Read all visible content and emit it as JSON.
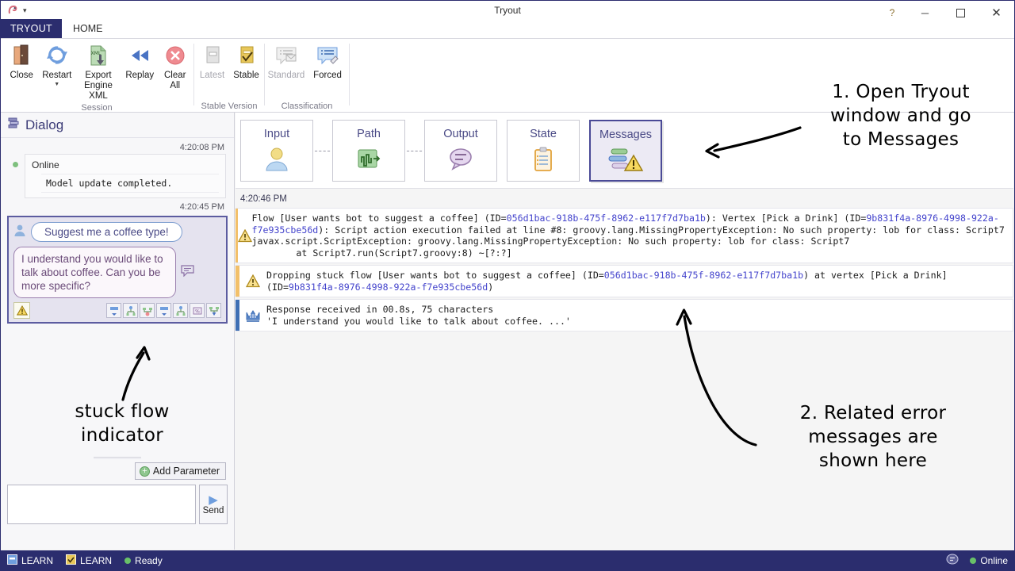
{
  "window": {
    "title": "Tryout",
    "help_glyph": "?",
    "minimize_glyph": "─",
    "maximize_glyph": "☐",
    "close_glyph": "✕",
    "collapse_glyph": "⌃",
    "qat_dropdown_glyph": "▾"
  },
  "tabs": {
    "app_tab": "TRYOUT",
    "ribbon_tab": "HOME"
  },
  "ribbon": {
    "groups": [
      {
        "title": "Session",
        "buttons": [
          {
            "label": "Close",
            "icon": "door-icon",
            "disabled": false,
            "dropdown": false
          },
          {
            "label": "Restart",
            "icon": "restart-icon",
            "disabled": false,
            "dropdown": true
          },
          {
            "label": "Export\nEngine XML",
            "label_line1": "Export",
            "label_line2": "Engine XML",
            "icon": "export-xml-icon",
            "disabled": false,
            "dropdown": false
          },
          {
            "label": "Replay",
            "icon": "rewind-icon",
            "disabled": false,
            "dropdown": false
          },
          {
            "label_line1": "Clear",
            "label_line2": "All",
            "label": "Clear All",
            "icon": "clear-all-icon",
            "disabled": false,
            "dropdown": false
          }
        ]
      },
      {
        "title": "Stable Version",
        "buttons": [
          {
            "label": "Latest",
            "icon": "latest-version-icon",
            "disabled": true,
            "dropdown": false
          },
          {
            "label": "Stable",
            "icon": "stable-version-icon",
            "disabled": false,
            "dropdown": false
          }
        ]
      },
      {
        "title": "Classification",
        "buttons": [
          {
            "label": "Standard",
            "icon": "standard-classification-icon",
            "disabled": true,
            "dropdown": false
          },
          {
            "label": "Forced",
            "icon": "forced-classification-icon",
            "disabled": false,
            "dropdown": false
          }
        ]
      }
    ]
  },
  "dialog": {
    "header": "Dialog",
    "header_icon": "dialog-icon",
    "system_message": {
      "timestamp": "4:20:08 PM",
      "status": "Online",
      "status_color": "#7ec07e",
      "text": "Model update completed."
    },
    "turn": {
      "timestamp": "4:20:45 PM",
      "user_text": "Suggest me a coffee type!",
      "bot_text": "I understand you would like to talk about coffee. Can you be more specific?",
      "warning_icon": "warning-triangle-icon",
      "tool_icons": [
        "input-transition-icon",
        "flow-node-icon",
        "stuck-flow-icon",
        "input-transition-icon",
        "flow-node-icon",
        "nlu-model-icon",
        "flow-tree-icon"
      ]
    },
    "add_parameter_label": "Add Parameter",
    "send_label": "Send",
    "send_input_value": "",
    "send_input_placeholder": ""
  },
  "main": {
    "tabs": [
      {
        "label": "Input",
        "icon": "user-icon",
        "active": false
      },
      {
        "label": "Path",
        "icon": "path-icon",
        "active": false
      },
      {
        "label": "Output",
        "icon": "speech-bubble-icon",
        "active": false
      },
      {
        "label": "State",
        "icon": "clipboard-icon",
        "active": false
      },
      {
        "label": "Messages",
        "icon": "messages-warning-icon",
        "active": true
      }
    ],
    "connector_glyph": "----",
    "log_timestamp": "4:20:46 PM",
    "log_rows": [
      {
        "severity": "warn",
        "icon": "warning-triangle-icon",
        "segments": [
          {
            "t": "Flow [User wants bot to suggest a coffee] (ID=",
            "link": false
          },
          {
            "t": "056d1bac-918b-475f-8962-e117f7d7ba1b",
            "link": true
          },
          {
            "t": "): Vertex [Pick a Drink] (ID=",
            "link": false
          },
          {
            "t": "9b831f4a-8976-4998-922a-f7e935cbe56d",
            "link": true
          },
          {
            "t": "): Script action execution failed at line #8: groovy.lang.MissingPropertyException: No such property: lob for class: Script7\njavax.script.ScriptException: groovy.lang.MissingPropertyException: No such property: lob for class: Script7\n        at Script7.run(Script7.groovy:8) ~[?:?]",
            "link": false
          }
        ]
      },
      {
        "severity": "warn",
        "icon": "warning-triangle-icon",
        "segments": [
          {
            "t": "Dropping stuck flow [User wants bot to suggest a coffee] (ID=",
            "link": false
          },
          {
            "t": "056d1bac-918b-475f-8962-e117f7d7ba1b",
            "link": true
          },
          {
            "t": ") at vertex [Pick a Drink]\n(ID=",
            "link": false
          },
          {
            "t": "9b831f4a-8976-4998-922a-f7e935cbe56d",
            "link": true
          },
          {
            "t": ")",
            "link": false
          }
        ]
      },
      {
        "severity": "info",
        "icon": "engine-response-icon",
        "segments": [
          {
            "t": "Response received in 00.8s, 75 characters\n'I understand you would like to talk about coffee. ...'",
            "link": false
          }
        ]
      }
    ]
  },
  "statusbar": {
    "items": [
      {
        "label": "LEARN",
        "icon": "learn-blue-icon"
      },
      {
        "label": "LEARN",
        "icon": "learn-yellow-icon"
      },
      {
        "label": "Ready",
        "icon": "ready-dot-icon"
      }
    ],
    "right": [
      {
        "label": "",
        "icon": "chat-icon"
      },
      {
        "label": "Online",
        "icon": "online-dot-icon"
      }
    ]
  },
  "annotations": {
    "note1": "1. Open Tryout window and go to Messages",
    "note1_lines": [
      "1. Open Tryout",
      "window and go",
      "to Messages"
    ],
    "note2": "2. Related error messages are shown here",
    "note2_lines": [
      "2. Related error",
      "messages are",
      "shown here"
    ],
    "note3": "stuck flow indicator",
    "note3_lines": [
      "stuck flow",
      "indicator"
    ]
  },
  "colors": {
    "brand": "#2b2d6e",
    "accent_warn": "#f2c06a",
    "accent_info": "#3f6fb5",
    "link": "#4444cc",
    "active_tab_border": "#4a4a96"
  }
}
